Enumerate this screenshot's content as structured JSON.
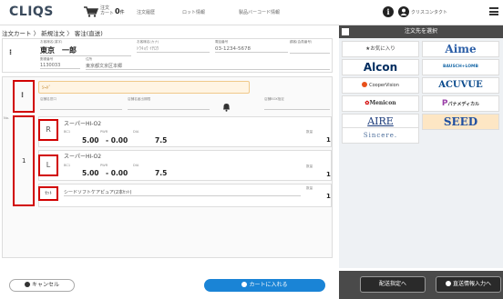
{
  "header": {
    "logo": "CLIQS",
    "cart_label": "注文\nカート",
    "cart_count": "0",
    "cart_unit": "件",
    "nav": [
      "注文履歴",
      "ロット情報",
      "製品バーコード情報"
    ],
    "user_name": "クリスコンタクト"
  },
  "breadcrumb": "注文カート 〉 新規注文 〉 客注(直送)",
  "customer": {
    "name_label": "お客様名(漢字)",
    "name_value": "東京　一郎",
    "kana_label": "お客様名(カナ)",
    "kana_value": "ﾄｳｷｮｳ ｲﾁﾛｳ",
    "phone_label": "電話番号",
    "phone_value": "03-1234-5678",
    "cardno_label": "顧客(会員番号)",
    "zip_label": "郵便番号",
    "zip_value": "1130033",
    "addr_label": "住所",
    "addr_value": "東京都文京区本郷"
  },
  "shop": {
    "input_value": "ｼｰﾄﾞ",
    "store_label": "店舗名窓口",
    "store_delivery_label": "店舗名届出期限",
    "box_label": "店舗BOX指定"
  },
  "order": {
    "no_label": "No.",
    "row_no": "1",
    "right_eye": "R",
    "left_eye": "L",
    "set_label": "ｾｯﾄ",
    "product_r": "スーパーHI-O2",
    "product_l": "スーパーHI-O2",
    "bc_label": "BC1",
    "pwr_label": "PWR",
    "dia_label": "DIA",
    "qty_label": "数量",
    "r_bc": "5.00",
    "r_pwr": "- 0.00",
    "r_dia": "7.5",
    "r_qty": "1",
    "l_bc": "5.00",
    "l_pwr": "- 0.00",
    "l_dia": "7.5",
    "l_qty": "1",
    "set_product": "シードソフトケアピュア(2本ｾｯﾄ)",
    "set_qty": "1"
  },
  "buttons": {
    "cancel": "キャンセル",
    "add_to_cart": "カートに入れる",
    "delivery_setting": "配送指定へ",
    "direct_info": "直送情報入力へ"
  },
  "right_panel": {
    "title": "注文先を選択",
    "favorites": "★お気に入り",
    "brands": [
      "Aime",
      "Alcon",
      "BAUSCH+LOMB",
      "CooperVision",
      "ACUVUE",
      "Menicon",
      "パナメディカル",
      "AIRE",
      "SEED",
      "Sincere."
    ]
  },
  "colors": {
    "accent_blue": "#1a84d6",
    "highlight_red": "#d10000",
    "shop_bg": "#fff4e3",
    "panel_dark": "#4a4a4a",
    "seed_bg": "#fde6c4"
  }
}
